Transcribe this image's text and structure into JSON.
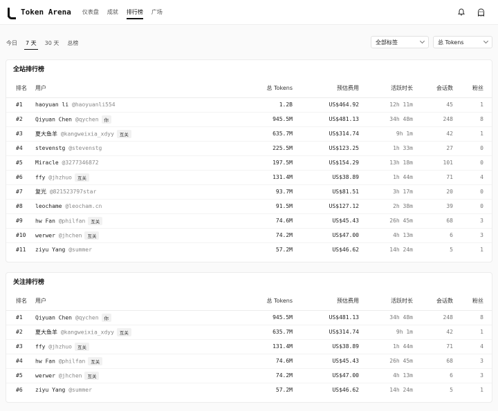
{
  "app": {
    "title": "Token Arena"
  },
  "nav": [
    {
      "label": "仪表盘",
      "active": false
    },
    {
      "label": "成就",
      "active": false
    },
    {
      "label": "排行榜",
      "active": true
    },
    {
      "label": "广场",
      "active": false
    }
  ],
  "icons": {
    "bell": "bell-icon",
    "profile": "ghost-icon"
  },
  "ranges": [
    {
      "label": "今日",
      "active": false
    },
    {
      "label": "7 天",
      "active": true
    },
    {
      "label": "30 天",
      "active": false
    },
    {
      "label": "总榜",
      "active": false
    }
  ],
  "filters": {
    "tags": "全部标签",
    "metric": "总 Tokens"
  },
  "columns": [
    "排名",
    "用户",
    "总 Tokens",
    "预估费用",
    "活跃时长",
    "会话数",
    "粉丝"
  ],
  "global": {
    "title": "全站排行榜",
    "rows": [
      {
        "rank": "#1",
        "name": "haoyuan li",
        "handle": "@haoyuanli554",
        "badge": "",
        "tokens": "1.2B",
        "cost": "US$464.92",
        "active": "12h 11m",
        "sessions": "45",
        "fans": "1"
      },
      {
        "rank": "#2",
        "name": "Qiyuan Chen",
        "handle": "@qychen",
        "badge": "你",
        "tokens": "945.5M",
        "cost": "US$481.13",
        "active": "34h 48m",
        "sessions": "248",
        "fans": "8"
      },
      {
        "rank": "#3",
        "name": "夏大鱼羊",
        "handle": "@kangweixia_xdyy",
        "badge": "互关",
        "tokens": "635.7M",
        "cost": "US$314.74",
        "active": "9h 1m",
        "sessions": "42",
        "fans": "1"
      },
      {
        "rank": "#4",
        "name": "stevenstg",
        "handle": "@stevenstg",
        "badge": "",
        "tokens": "225.5M",
        "cost": "US$123.25",
        "active": "1h 33m",
        "sessions": "27",
        "fans": "0"
      },
      {
        "rank": "#5",
        "name": "Miracle",
        "handle": "@3277346872",
        "badge": "",
        "tokens": "197.5M",
        "cost": "US$154.29",
        "active": "13h 18m",
        "sessions": "101",
        "fans": "0"
      },
      {
        "rank": "#6",
        "name": "ffy",
        "handle": "@jhzhuo",
        "badge": "互关",
        "tokens": "131.4M",
        "cost": "US$38.89",
        "active": "1h 44m",
        "sessions": "71",
        "fans": "4"
      },
      {
        "rank": "#7",
        "name": "复光",
        "handle": "@821523797star",
        "badge": "",
        "tokens": "93.7M",
        "cost": "US$81.51",
        "active": "3h 17m",
        "sessions": "20",
        "fans": "0"
      },
      {
        "rank": "#8",
        "name": "leochame",
        "handle": "@leocham.cn",
        "badge": "",
        "tokens": "91.5M",
        "cost": "US$127.12",
        "active": "2h 38m",
        "sessions": "39",
        "fans": "0"
      },
      {
        "rank": "#9",
        "name": "hw Fan",
        "handle": "@philfan",
        "badge": "互关",
        "tokens": "74.6M",
        "cost": "US$45.43",
        "active": "26h 45m",
        "sessions": "68",
        "fans": "3"
      },
      {
        "rank": "#10",
        "name": "werwer",
        "handle": "@jhchen",
        "badge": "互关",
        "tokens": "74.2M",
        "cost": "US$47.00",
        "active": "4h 13m",
        "sessions": "6",
        "fans": "3"
      },
      {
        "rank": "#11",
        "name": "ziyu Yang",
        "handle": "@summer",
        "badge": "",
        "tokens": "57.2M",
        "cost": "US$46.62",
        "active": "14h 24m",
        "sessions": "5",
        "fans": "1"
      }
    ]
  },
  "following": {
    "title": "关注排行榜",
    "rows": [
      {
        "rank": "#1",
        "name": "Qiyuan Chen",
        "handle": "@qychen",
        "badge": "你",
        "tokens": "945.5M",
        "cost": "US$481.13",
        "active": "34h 48m",
        "sessions": "248",
        "fans": "8"
      },
      {
        "rank": "#2",
        "name": "夏大鱼羊",
        "handle": "@kangweixia_xdyy",
        "badge": "互关",
        "tokens": "635.7M",
        "cost": "US$314.74",
        "active": "9h 1m",
        "sessions": "42",
        "fans": "1"
      },
      {
        "rank": "#3",
        "name": "ffy",
        "handle": "@jhzhuo",
        "badge": "互关",
        "tokens": "131.4M",
        "cost": "US$38.89",
        "active": "1h 44m",
        "sessions": "71",
        "fans": "4"
      },
      {
        "rank": "#4",
        "name": "hw Fan",
        "handle": "@philfan",
        "badge": "互关",
        "tokens": "74.6M",
        "cost": "US$45.43",
        "active": "26h 45m",
        "sessions": "68",
        "fans": "3"
      },
      {
        "rank": "#5",
        "name": "werwer",
        "handle": "@jhchen",
        "badge": "互关",
        "tokens": "74.2M",
        "cost": "US$47.00",
        "active": "4h 13m",
        "sessions": "6",
        "fans": "3"
      },
      {
        "rank": "#6",
        "name": "ziyu Yang",
        "handle": "@summer",
        "badge": "",
        "tokens": "57.2M",
        "cost": "US$46.62",
        "active": "14h 24m",
        "sessions": "5",
        "fans": "1"
      }
    ]
  }
}
